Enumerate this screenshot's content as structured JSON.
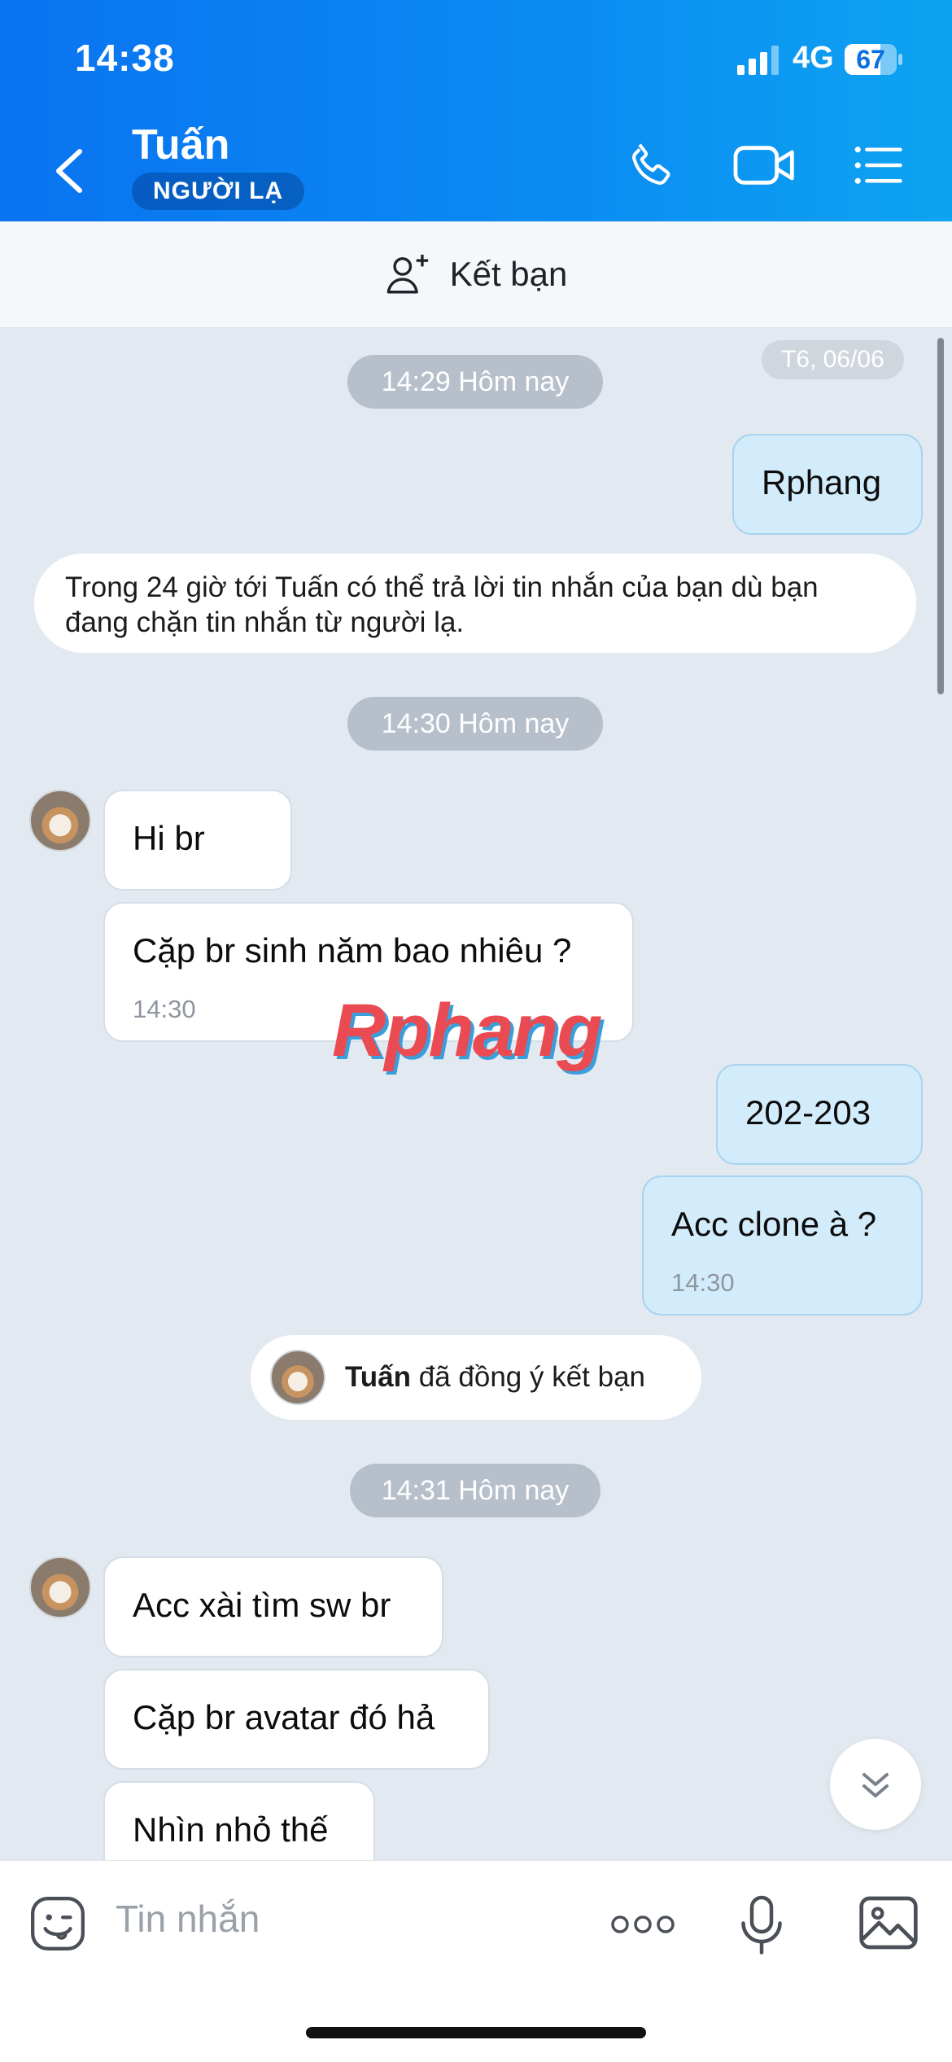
{
  "status_bar": {
    "time": "14:38",
    "network": "4G",
    "battery": "67"
  },
  "header": {
    "contact_name": "Tuấn",
    "badge": "NGƯỜI LẠ"
  },
  "add_friend": {
    "label": "Kết bạn"
  },
  "chat": {
    "date_label": "T6, 06/06",
    "divider_1": "14:29 Hôm nay",
    "msg_out_1": "Rphang",
    "notice": "Trong 24 giờ tới Tuấn có thể trả lời tin nhắn của bạn dù bạn đang chặn tin nhắn từ người lạ.",
    "divider_2": "14:30 Hôm nay",
    "msg_in_1": "Hi br",
    "msg_in_2": "Cặp br sinh năm bao nhiêu ?",
    "msg_in_2_time": "14:30",
    "msg_out_2": "202-203",
    "msg_out_3": "Acc clone à ?",
    "msg_out_3_time": "14:30",
    "friend_accept_name": "Tuấn",
    "friend_accept_text": "đã đồng ý kết bạn",
    "divider_3": "14:31 Hôm nay",
    "msg_in_3": "Acc xài tìm sw br",
    "msg_in_4": "Cặp br avatar đó hả",
    "msg_in_5": "Nhìn nhỏ thế"
  },
  "watermark": "Rphang",
  "input": {
    "placeholder": "Tin nhắn"
  },
  "icons": [
    "back-icon",
    "phone-icon",
    "video-icon",
    "menu-icon",
    "add-person-icon",
    "chevron-double-down-icon",
    "emoji-icon",
    "more-icon",
    "mic-icon",
    "image-icon"
  ]
}
